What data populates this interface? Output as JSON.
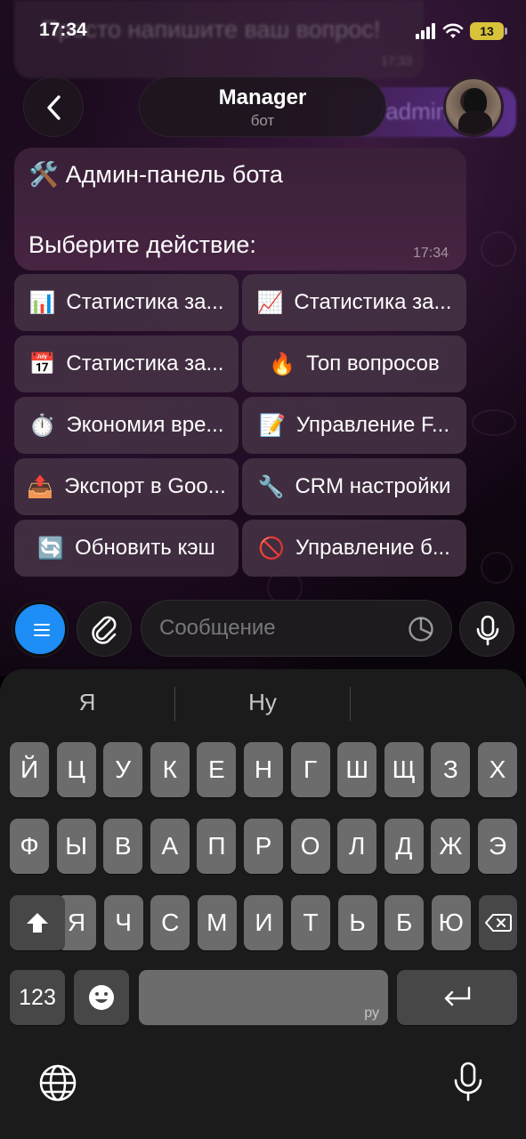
{
  "status_bar": {
    "time": "17:34",
    "battery": "13"
  },
  "background": {
    "prev_message": "Просто напишите ваш вопрос!",
    "prev_time": "17:33",
    "prev_out": "/admin"
  },
  "header": {
    "title": "Manager",
    "subtitle": "бот"
  },
  "message": {
    "emoji": "🛠️",
    "title": "Админ-панель бота",
    "body": "Выберите действие:",
    "time": "17:34"
  },
  "inline_keyboard": [
    {
      "emoji": "📊",
      "label": "Статистика за..."
    },
    {
      "emoji": "📈",
      "label": "Статистика за..."
    },
    {
      "emoji": "📅",
      "label": "Статистика за..."
    },
    {
      "emoji": "🔥",
      "label": "Топ вопросов"
    },
    {
      "emoji": "⏱️",
      "label": "Экономия вре..."
    },
    {
      "emoji": "📝",
      "label": "Управление F..."
    },
    {
      "emoji": "📤",
      "label": "Экспорт в Goo..."
    },
    {
      "emoji": "🔧",
      "label": "CRM настройки"
    },
    {
      "emoji": "🔄",
      "label": "Обновить кэш"
    },
    {
      "emoji": "🚫",
      "label": "Управление б..."
    }
  ],
  "composer": {
    "placeholder": "Сообщение"
  },
  "keyboard": {
    "suggestions": [
      "Я",
      "Ну",
      ""
    ],
    "row1": [
      "Й",
      "Ц",
      "У",
      "К",
      "Е",
      "Н",
      "Г",
      "Ш",
      "Щ",
      "З",
      "Х"
    ],
    "row2": [
      "Ф",
      "Ы",
      "В",
      "А",
      "П",
      "Р",
      "О",
      "Л",
      "Д",
      "Ж",
      "Э"
    ],
    "row3": [
      "Я",
      "Ч",
      "С",
      "М",
      "И",
      "Т",
      "Ь",
      "Б",
      "Ю"
    ],
    "numbers_key": "123",
    "space_lang": "ру"
  },
  "colors": {
    "accent": "#1e8df5",
    "bubble": "#472442",
    "battery": "#d8c23a"
  }
}
